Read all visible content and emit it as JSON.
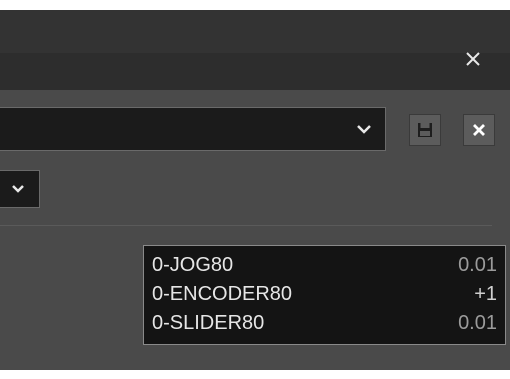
{
  "window": {
    "close_icon": "close-icon"
  },
  "toolbar": {
    "save_icon": "floppy-disk-icon",
    "delete_icon": "close-icon",
    "preset_value": "",
    "secondary_value": ""
  },
  "mappings": [
    {
      "name": "0-JOG80",
      "value": "0.01"
    },
    {
      "name": "0-ENCODER80",
      "value": "+1"
    },
    {
      "name": "0-SLIDER80",
      "value": "0.01"
    }
  ],
  "colors": {
    "background": "#4a4a4a",
    "titlebar": "#2d2d2d",
    "field": "#1b1b1b",
    "button": "#5c5c5c",
    "mapping_box": "#141414"
  }
}
